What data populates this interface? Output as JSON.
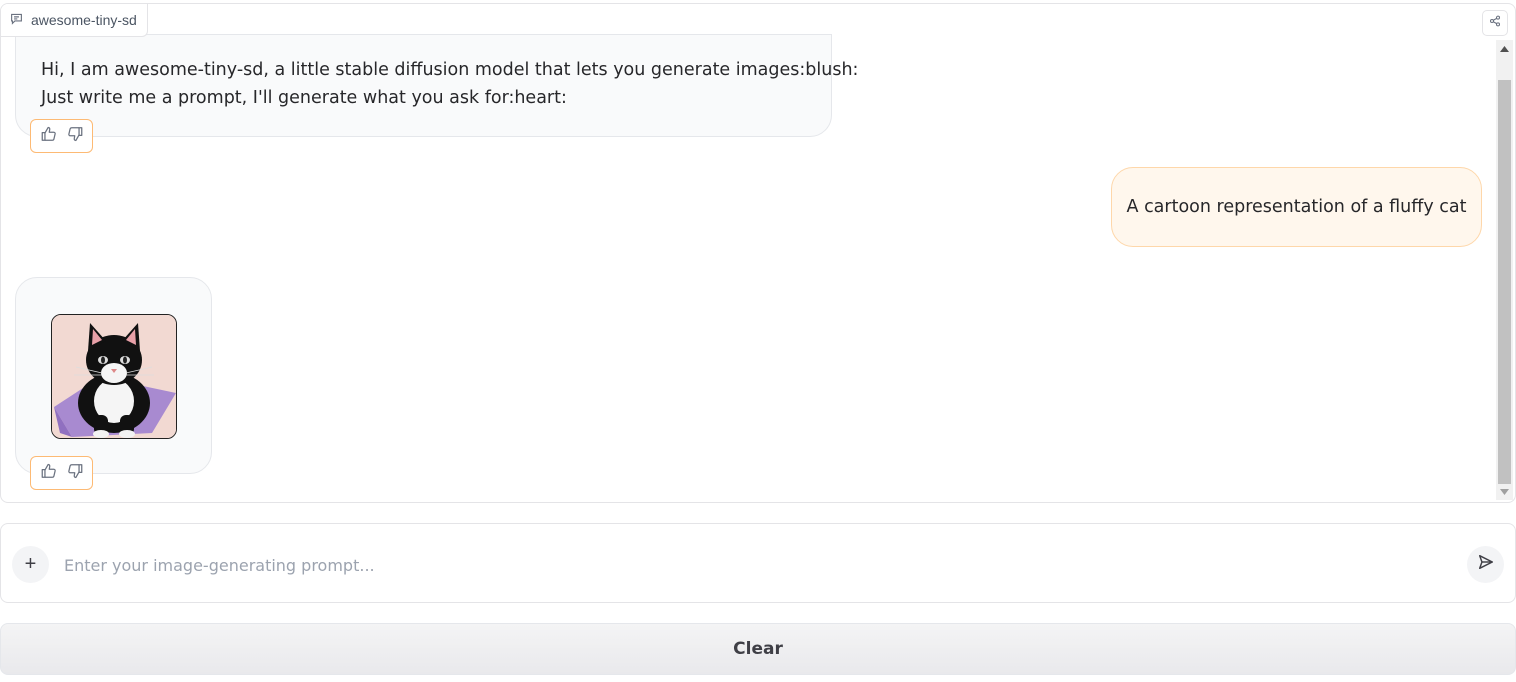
{
  "chatbot": {
    "label": "awesome-tiny-sd",
    "label_icon": "chat-icon",
    "share_icon": "share-icon"
  },
  "messages": [
    {
      "role": "bot",
      "lines": [
        "Hi, I am awesome-tiny-sd, a little stable diffusion model that lets you generate images:blush:",
        "Just write me a prompt, I'll generate what you ask for:heart:"
      ]
    },
    {
      "role": "user",
      "text": "A cartoon representation of a fluffy cat"
    },
    {
      "role": "bot",
      "image": "generated-cat-image"
    }
  ],
  "feedback": {
    "like_icon": "thumbs-up-icon",
    "dislike_icon": "thumbs-down-icon"
  },
  "input": {
    "placeholder": "Enter your image-generating prompt...",
    "value": "",
    "upload_label": "+",
    "send_icon": "send-icon"
  },
  "actions": {
    "clear_label": "Clear"
  }
}
